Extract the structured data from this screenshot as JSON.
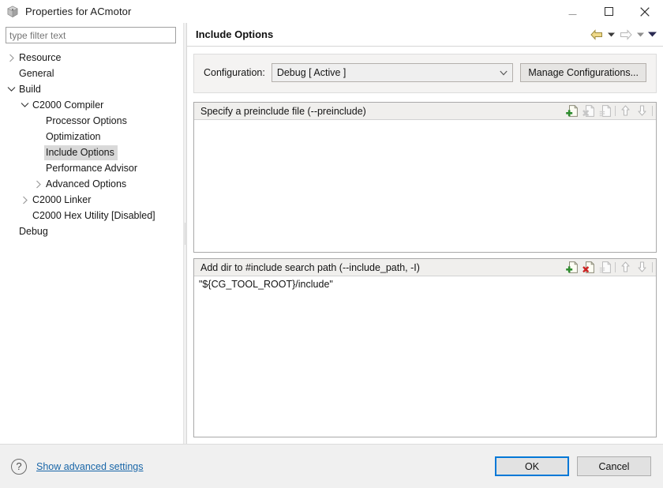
{
  "window": {
    "title": "Properties for ACmotor",
    "icon": "project-cube-icon",
    "minimize_label": "Minimize",
    "maximize_label": "Maximize",
    "close_label": "Close"
  },
  "filter": {
    "placeholder": "type filter text",
    "value": ""
  },
  "tree": {
    "items": [
      {
        "label": "Resource",
        "indent": 0,
        "twisty": "collapsed",
        "selected": false
      },
      {
        "label": "General",
        "indent": 0,
        "twisty": "none",
        "selected": false
      },
      {
        "label": "Build",
        "indent": 0,
        "twisty": "expanded",
        "selected": false
      },
      {
        "label": "C2000 Compiler",
        "indent": 1,
        "twisty": "expanded",
        "selected": false
      },
      {
        "label": "Processor Options",
        "indent": 2,
        "twisty": "none",
        "selected": false
      },
      {
        "label": "Optimization",
        "indent": 2,
        "twisty": "none",
        "selected": false
      },
      {
        "label": "Include Options",
        "indent": 2,
        "twisty": "none",
        "selected": true
      },
      {
        "label": "Performance Advisor",
        "indent": 2,
        "twisty": "none",
        "selected": false
      },
      {
        "label": "Advanced Options",
        "indent": 2,
        "twisty": "collapsed",
        "selected": false
      },
      {
        "label": "C2000 Linker",
        "indent": 1,
        "twisty": "collapsed",
        "selected": false
      },
      {
        "label": "C2000 Hex Utility  [Disabled]",
        "indent": 1,
        "twisty": "none",
        "selected": false
      },
      {
        "label": "Debug",
        "indent": 0,
        "twisty": "none",
        "selected": false
      }
    ]
  },
  "page": {
    "title": "Include Options",
    "nav": {
      "back_label": "Back",
      "back_menu_label": "Back history",
      "forward_label": "Forward",
      "forward_menu_label": "Forward history",
      "view_menu_label": "View menu"
    }
  },
  "configuration": {
    "label": "Configuration:",
    "selected": "Debug  [ Active ]",
    "options": [
      "Debug  [ Active ]"
    ],
    "manage_button": "Manage Configurations..."
  },
  "sections": [
    {
      "title": "Specify a preinclude file (--preinclude)",
      "items": [],
      "tools": [
        {
          "name": "add-icon",
          "label": "Add",
          "state": "enabled"
        },
        {
          "name": "delete-icon",
          "label": "Delete",
          "state": "disabled"
        },
        {
          "name": "edit-icon",
          "label": "Edit",
          "state": "disabled"
        },
        {
          "name": "move-up-icon",
          "label": "Move Up",
          "state": "disabled"
        },
        {
          "name": "move-down-icon",
          "label": "Move Down",
          "state": "disabled"
        }
      ]
    },
    {
      "title": "Add dir to #include search path (--include_path, -I)",
      "items": [
        "\"${CG_TOOL_ROOT}/include\""
      ],
      "tools": [
        {
          "name": "add-icon",
          "label": "Add",
          "state": "enabled"
        },
        {
          "name": "delete-icon",
          "label": "Delete",
          "state": "enabled"
        },
        {
          "name": "edit-icon",
          "label": "Edit",
          "state": "disabled"
        },
        {
          "name": "move-up-icon",
          "label": "Move Up",
          "state": "disabled"
        },
        {
          "name": "move-down-icon",
          "label": "Move Down",
          "state": "disabled"
        }
      ]
    }
  ],
  "footer": {
    "help_glyph": "?",
    "advanced_link": "Show advanced settings",
    "ok_label": "OK",
    "cancel_label": "Cancel"
  },
  "colors": {
    "accent": "#0078d7",
    "link": "#1966a8",
    "selection": "#d9d9d9",
    "add_icon": "#2e8b2e",
    "delete_icon": "#cc2222",
    "back_arrow": "#e8d26a",
    "footer_bg": "#f0f0f0"
  }
}
